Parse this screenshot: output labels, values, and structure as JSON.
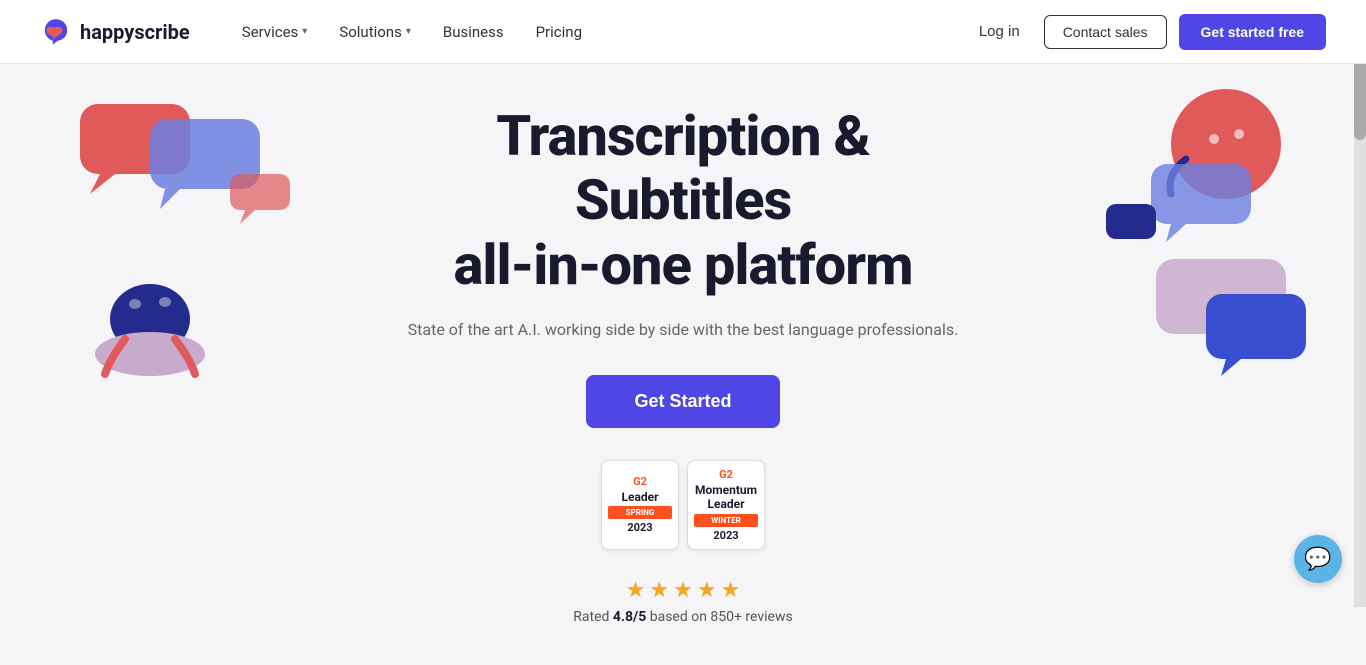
{
  "brand": {
    "name": "happyscribe",
    "logo_alt": "HappyScribe logo"
  },
  "navbar": {
    "services_label": "Services",
    "solutions_label": "Solutions",
    "business_label": "Business",
    "pricing_label": "Pricing",
    "login_label": "Log in",
    "contact_sales_label": "Contact sales",
    "get_started_label": "Get started free"
  },
  "hero": {
    "title_line1": "Transcription & Subtitles",
    "title_line2": "all-in-one platform",
    "subtitle": "State of the art A.I. working side by side with the best language professionals.",
    "cta_label": "Get Started"
  },
  "badges": [
    {
      "g2_label": "G2",
      "title": "Leader",
      "bar_label": "SPRING",
      "year": "2023"
    },
    {
      "g2_label": "G2",
      "title": "Momentum Leader",
      "bar_label": "WINTER",
      "year": "2023"
    }
  ],
  "rating": {
    "stars": 4.8,
    "max_stars": 5,
    "score": "4.8",
    "denominator": "5",
    "based_on": "based on 850+ reviews"
  },
  "colors": {
    "primary": "#5046e5",
    "accent_red": "#e05a5a",
    "accent_blue": "#4a5fe0",
    "accent_blue_dark": "#232b8c",
    "accent_purple": "#b8a8d8",
    "accent_pink": "#e8a0b0",
    "chat_button": "#5ab4e5",
    "badge_orange": "#ff4f1f"
  }
}
